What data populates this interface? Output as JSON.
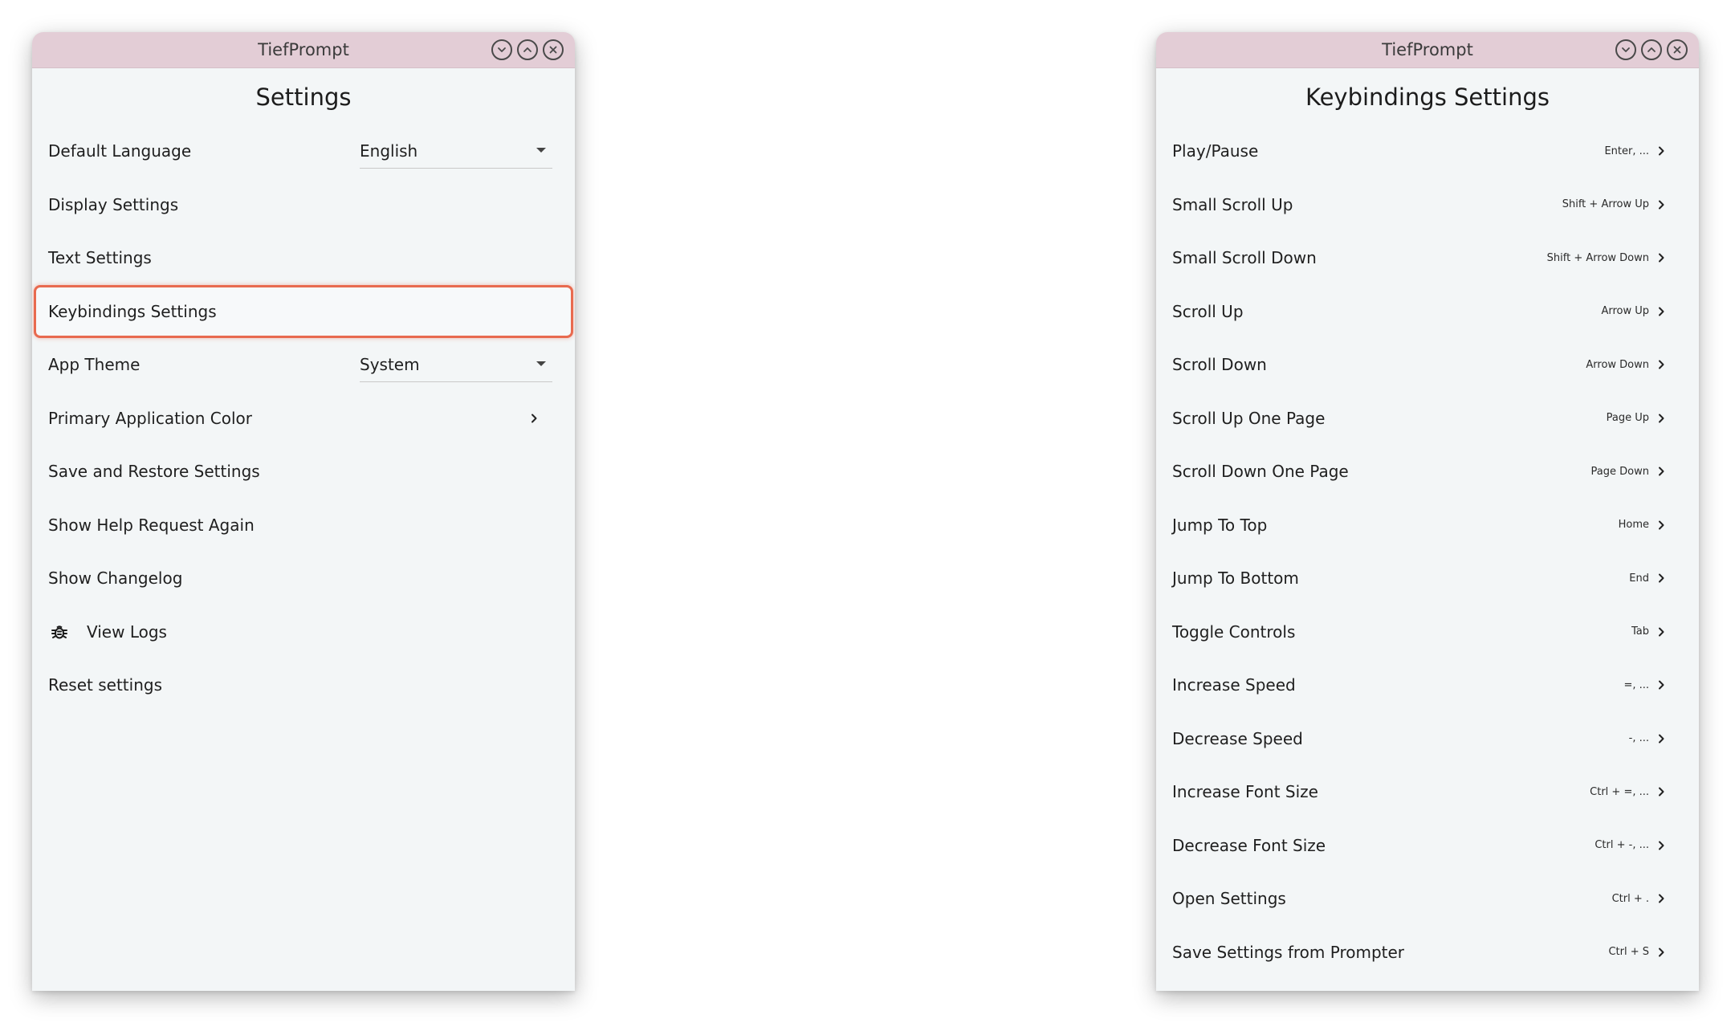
{
  "left_window": {
    "title": "TiefPrompt",
    "page_title": "Settings",
    "default_language": {
      "label": "Default Language",
      "value": "English"
    },
    "display_settings": "Display Settings",
    "text_settings": "Text Settings",
    "keybindings_settings": "Keybindings Settings",
    "app_theme": {
      "label": "App Theme",
      "value": "System"
    },
    "primary_color": "Primary Application Color",
    "save_restore": "Save and Restore Settings",
    "show_help": "Show Help Request Again",
    "show_changelog": "Show Changelog",
    "view_logs": "View Logs",
    "reset_settings": "Reset settings"
  },
  "right_window": {
    "title": "TiefPrompt",
    "page_title": "Keybindings Settings",
    "items": [
      {
        "label": "Play/Pause",
        "shortcut": "Enter, ..."
      },
      {
        "label": "Small Scroll Up",
        "shortcut": "Shift + Arrow Up"
      },
      {
        "label": "Small Scroll Down",
        "shortcut": "Shift + Arrow Down"
      },
      {
        "label": "Scroll Up",
        "shortcut": "Arrow Up"
      },
      {
        "label": "Scroll Down",
        "shortcut": "Arrow Down"
      },
      {
        "label": "Scroll Up One Page",
        "shortcut": "Page Up"
      },
      {
        "label": "Scroll Down One Page",
        "shortcut": "Page Down"
      },
      {
        "label": "Jump To Top",
        "shortcut": "Home"
      },
      {
        "label": "Jump To Bottom",
        "shortcut": "End"
      },
      {
        "label": "Toggle Controls",
        "shortcut": "Tab"
      },
      {
        "label": "Increase Speed",
        "shortcut": "=, ..."
      },
      {
        "label": "Decrease Speed",
        "shortcut": "-, ..."
      },
      {
        "label": "Increase Font Size",
        "shortcut": "Ctrl + =, ..."
      },
      {
        "label": "Decrease Font Size",
        "shortcut": "Ctrl + -, ..."
      },
      {
        "label": "Open Settings",
        "shortcut": "Ctrl + ."
      },
      {
        "label": "Save Settings from Prompter",
        "shortcut": "Ctrl + S"
      }
    ]
  },
  "colors": {
    "titlebar": "#e3cdd6",
    "window_bg": "#f3f6f7",
    "highlight": "#e86a4f"
  },
  "icons": {
    "minimize": "chevron-down-circle-icon",
    "maximize": "chevron-up-circle-icon",
    "close": "close-circle-icon",
    "dropdown": "caret-down-icon",
    "navigate": "chevron-right-icon",
    "logs": "bug-icon"
  }
}
